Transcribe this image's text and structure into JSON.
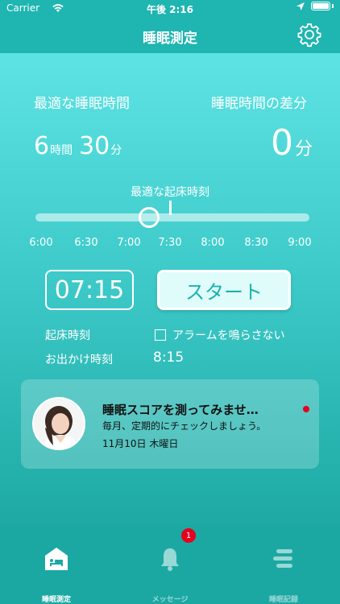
{
  "status_bar": {
    "carrier": "Carrier",
    "time": "午後 2:16"
  },
  "nav": {
    "title": "睡眠測定"
  },
  "summary": {
    "optimal_label": "最適な睡眠時間",
    "diff_label": "睡眠時間の差分",
    "hours": "6",
    "hours_unit": "時間",
    "minutes": "30",
    "minutes_unit": "分",
    "diff_value": "0",
    "diff_unit": "分"
  },
  "wake_slider": {
    "label": "最適な起床時刻",
    "ticks": [
      "6:00",
      "6:30",
      "7:00",
      "7:30",
      "8:00",
      "8:30",
      "9:00"
    ],
    "value": "7:15"
  },
  "alarm": {
    "time": "07:15",
    "start_label": "スタート",
    "wake_time_label": "起床時刻",
    "no_alarm_label": "アラームを鳴らさない",
    "no_alarm_checked": false,
    "departure_label": "お出かけ時刻",
    "departure_time": "8:15"
  },
  "card": {
    "title": "睡眠スコアを測ってみませ…",
    "subtitle": "毎月、定期的にチェックしましょう。",
    "date": "11月10日 木曜日"
  },
  "tabs": [
    {
      "label": "睡眠測定",
      "icon": "bed-home-icon",
      "active": true
    },
    {
      "label": "メッセージ",
      "icon": "bell-icon",
      "active": false,
      "badge": "1"
    },
    {
      "label": "睡眠記録",
      "icon": "records-list-icon",
      "active": false
    }
  ],
  "colors": {
    "accent": "#1fb5b1",
    "badge": "#e6001f",
    "start_bg": "#dffcfb"
  }
}
